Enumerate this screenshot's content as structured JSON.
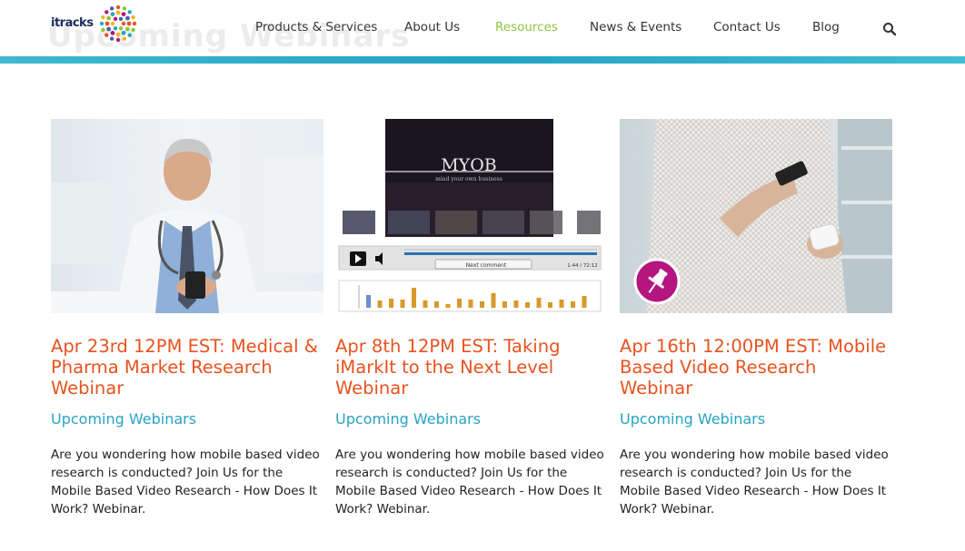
{
  "brand": {
    "logo_text": "itracks"
  },
  "hero": {
    "ghost_title": "Upcoming Webinars"
  },
  "nav": {
    "items": [
      {
        "label": "Products & Services",
        "active": false
      },
      {
        "label": "About Us",
        "active": false
      },
      {
        "label": "Resources",
        "active": true
      },
      {
        "label": "News & Events",
        "active": false
      },
      {
        "label": "Contact Us",
        "active": false
      },
      {
        "label": "Blog",
        "active": false
      }
    ],
    "search_icon": "search-icon"
  },
  "cards": [
    {
      "title": "Apr 23rd 12PM EST: Medical & Pharma Market Research Webinar",
      "category": "Upcoming Webinars",
      "description": "Are you wondering how mobile based video research is conducted? Join Us for the Mobile Based Video Research - How Does It Work? Webinar."
    },
    {
      "title": "Apr 8th 12PM EST: Taking iMarkIt to the Next Level Webinar",
      "category": "Upcoming Webinars",
      "description": "Are you wondering how mobile based video research is conducted? Join Us for the Mobile Based Video Research - How Does It Work? Webinar.",
      "player": {
        "video_title": "MYOB",
        "video_subtitle": "mind your own business",
        "next_comment": "Next comment",
        "time": "1:44 / 72:12"
      }
    },
    {
      "title": "Apr 16th 12:00PM EST: Mobile Based Video Research Webinar",
      "category": "Upcoming Webinars",
      "description": "Are you wondering how mobile based video research is conducted? Join Us for the Mobile Based Video Research - How Does It Work? Webinar.",
      "badge_icon": "pin-icon"
    }
  ],
  "colors": {
    "accent_orange": "#e8531f",
    "accent_teal": "#28a3c2",
    "nav_active": "#8cc63f",
    "badge_magenta": "#b5157f"
  }
}
